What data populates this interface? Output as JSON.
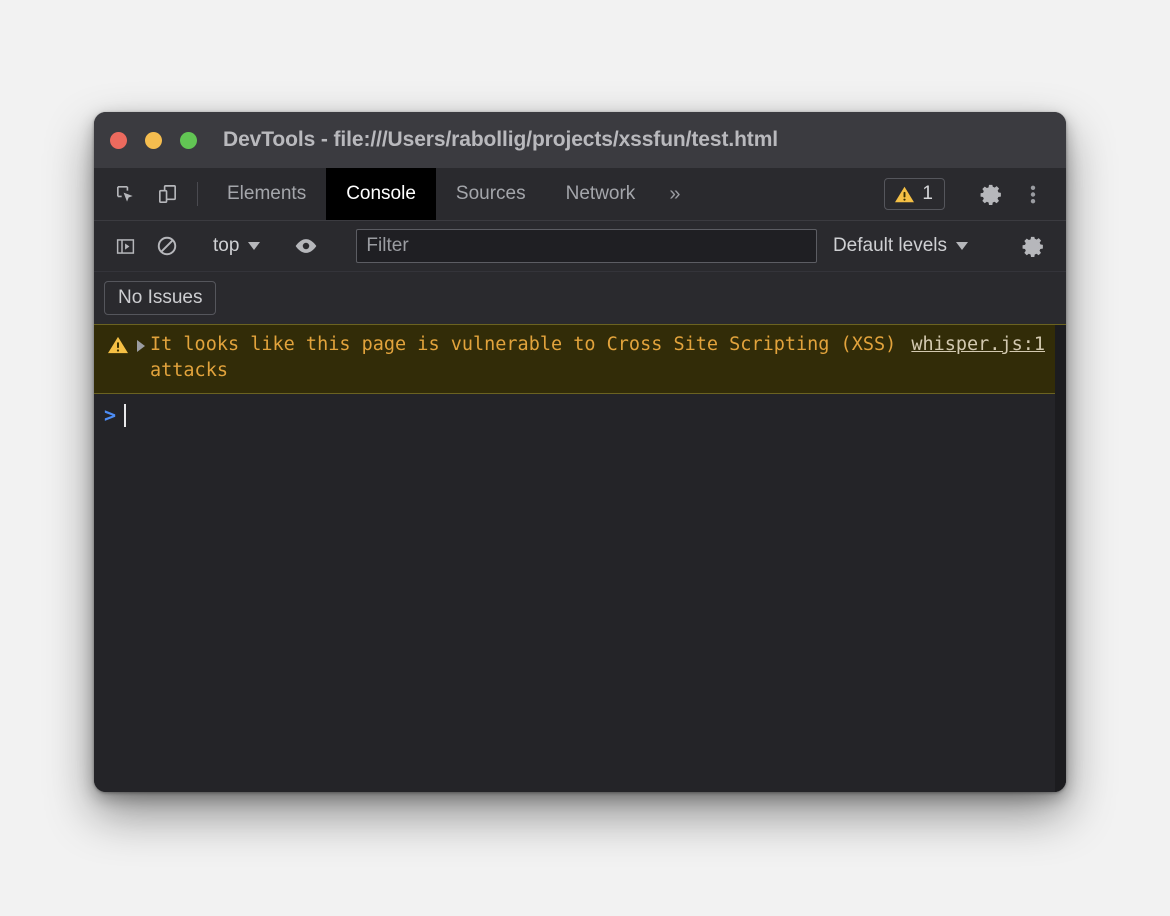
{
  "window": {
    "title": "DevTools - file:///Users/rabollig/projects/xssfun/test.html",
    "traffic_lights": {
      "close_label": "close",
      "minimize_label": "minimize",
      "maximize_label": "maximize",
      "close_color": "#ec6a5e",
      "minimize_color": "#f5bd4f",
      "maximize_color": "#62c554"
    }
  },
  "tab_bar": {
    "inspect_icon": "inspect-element-icon",
    "device_icon": "device-toolbar-icon",
    "tabs": [
      {
        "label": "Elements",
        "active": false
      },
      {
        "label": "Console",
        "active": true
      },
      {
        "label": "Sources",
        "active": false
      },
      {
        "label": "Network",
        "active": false
      }
    ],
    "more_tabs_label": "»",
    "issues_badge": {
      "icon": "warning-triangle-icon",
      "count": "1",
      "color": "#f5c045"
    },
    "settings_icon": "gear-icon",
    "menu_icon": "kebab-menu-icon"
  },
  "console_toolbar": {
    "sidebar_toggle_icon": "console-sidebar-icon",
    "clear_icon": "clear-console-icon",
    "context": {
      "label": "top",
      "caret": "▾"
    },
    "eye_icon": "live-expression-eye-icon",
    "filter": {
      "value": "",
      "placeholder": "Filter"
    },
    "levels": {
      "label": "Default levels",
      "caret": "▾"
    },
    "settings_icon": "console-settings-gear-icon"
  },
  "issues_bar": {
    "button_label": "No Issues"
  },
  "console": {
    "messages": [
      {
        "type": "warning",
        "icon": "warning-triangle-icon",
        "expandable": true,
        "text": "It looks like this page is vulnerable to Cross Site Scripting (XSS) attacks",
        "source": "whisper.js:1",
        "background": "#322c08",
        "text_color": "#e2a33c"
      }
    ],
    "prompt": {
      "chevron": ">",
      "input_value": ""
    }
  }
}
